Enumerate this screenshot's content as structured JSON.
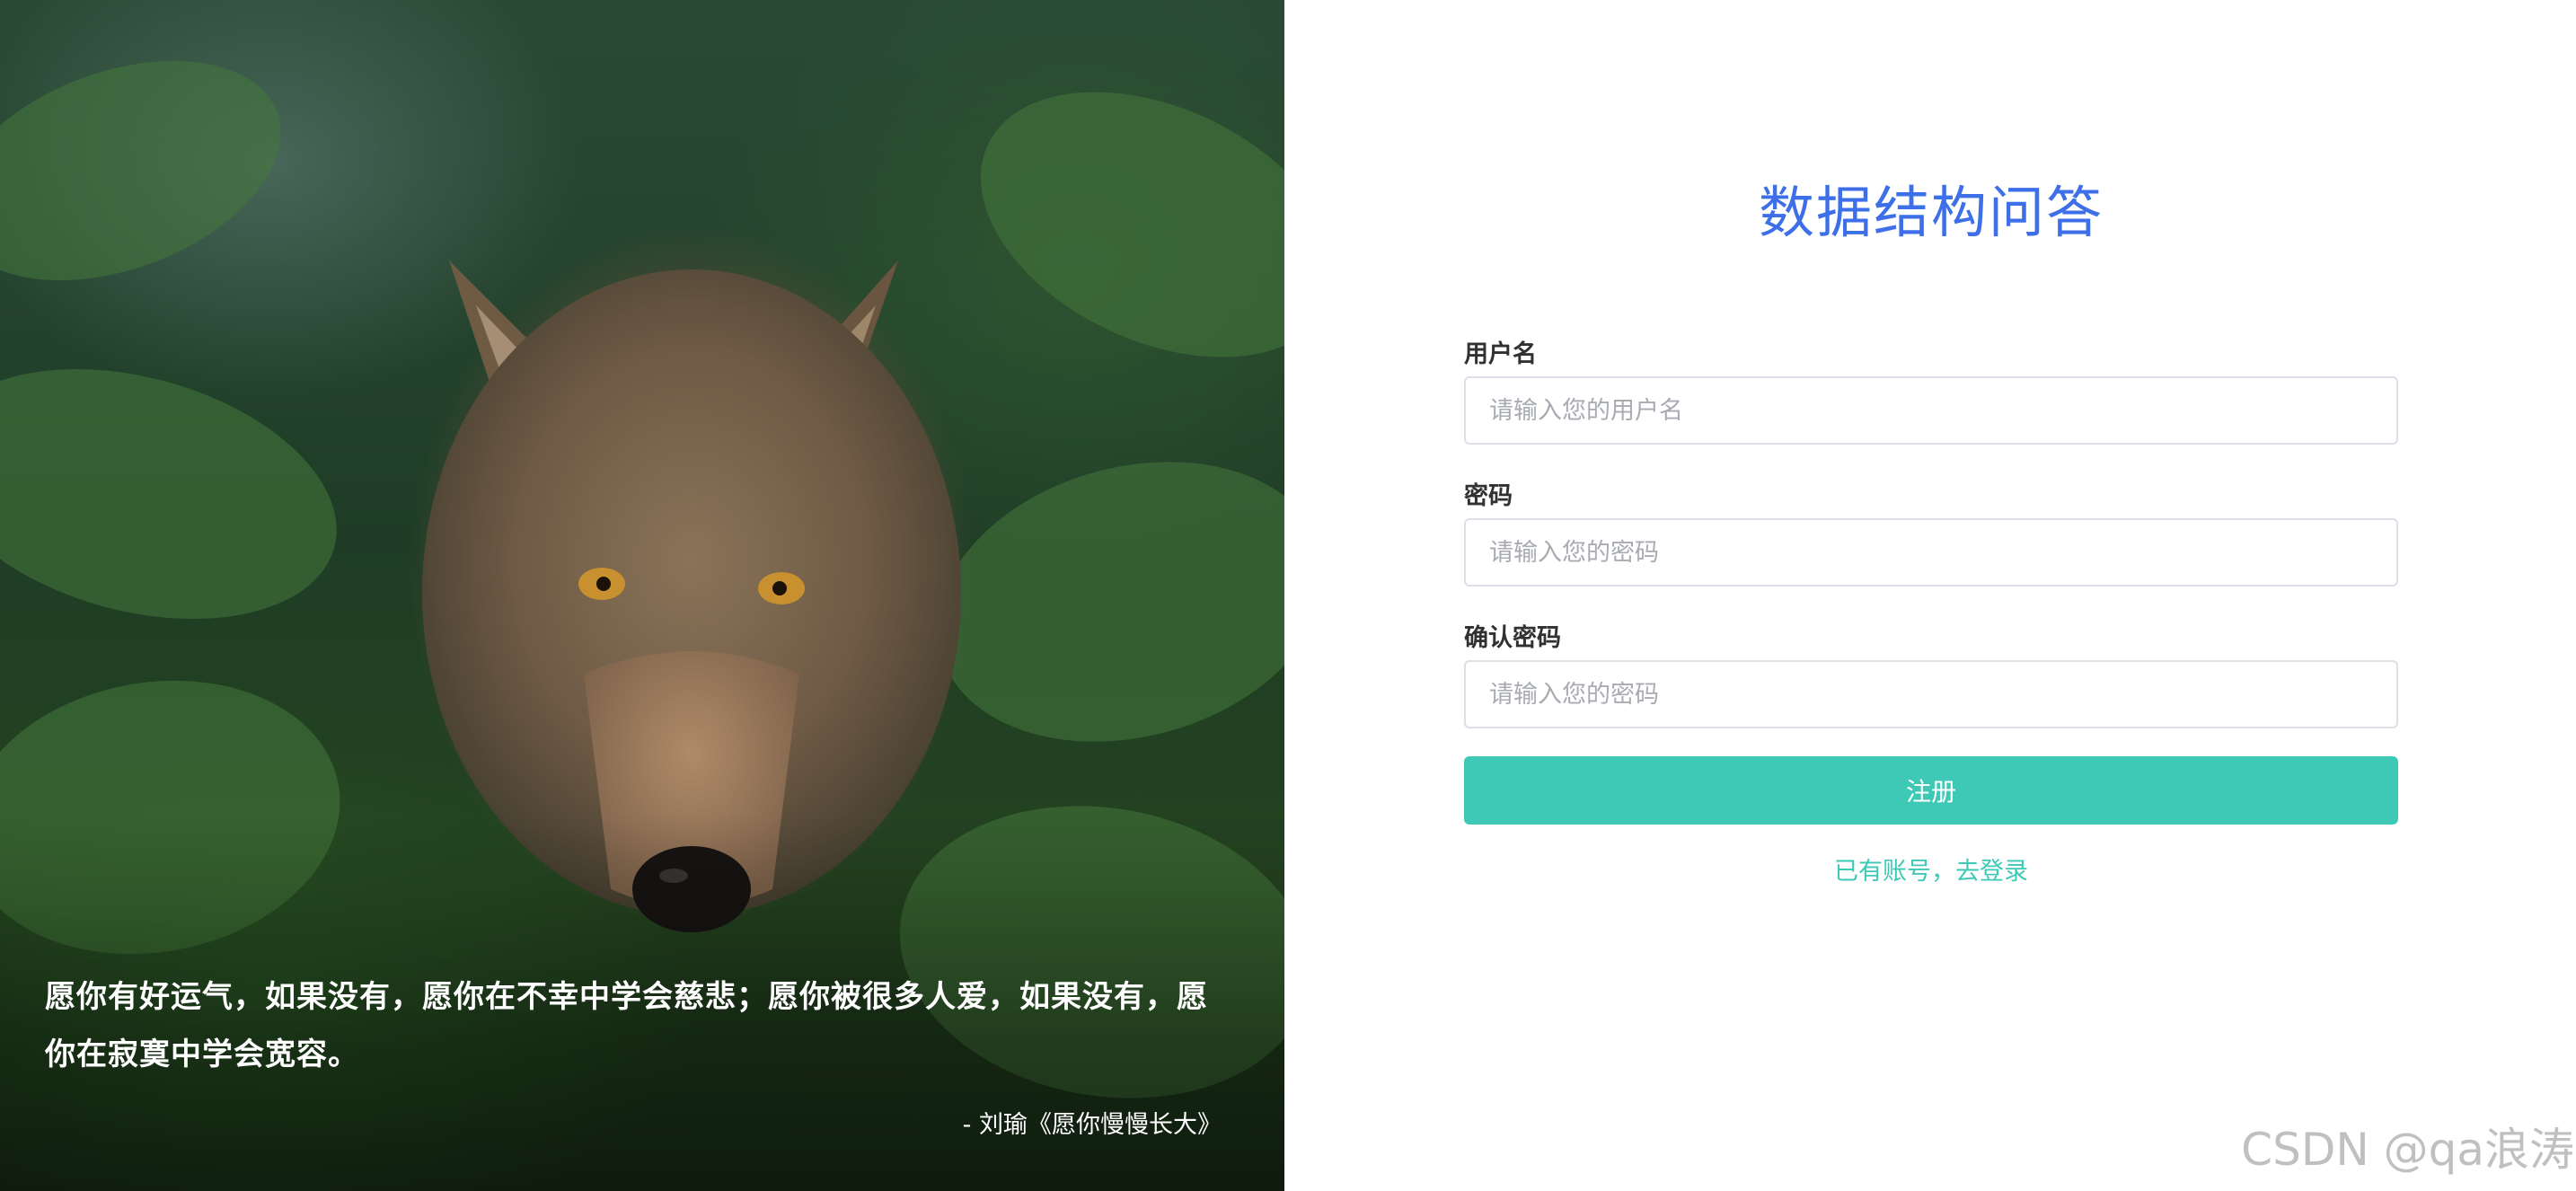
{
  "hero": {
    "quote": "愿你有好运气，如果没有，愿你在不幸中学会慈悲；愿你被很多人爱，如果没有，愿你在寂寞中学会宽容。",
    "author": "- 刘瑜《愿你慢慢长大》"
  },
  "form": {
    "title": "数据结构问答",
    "username": {
      "label": "用户名",
      "placeholder": "请输入您的用户名",
      "value": ""
    },
    "password": {
      "label": "密码",
      "placeholder": "请输入您的密码",
      "value": ""
    },
    "confirm_password": {
      "label": "确认密码",
      "placeholder": "请输入您的密码",
      "value": ""
    },
    "submit_label": "注册",
    "login_link": "已有账号，去登录"
  },
  "watermark": "CSDN @qa浪涛",
  "colors": {
    "title": "#3d6fe8",
    "accent": "#3ec9b7",
    "label": "#303133",
    "border": "#dcdfe6"
  }
}
